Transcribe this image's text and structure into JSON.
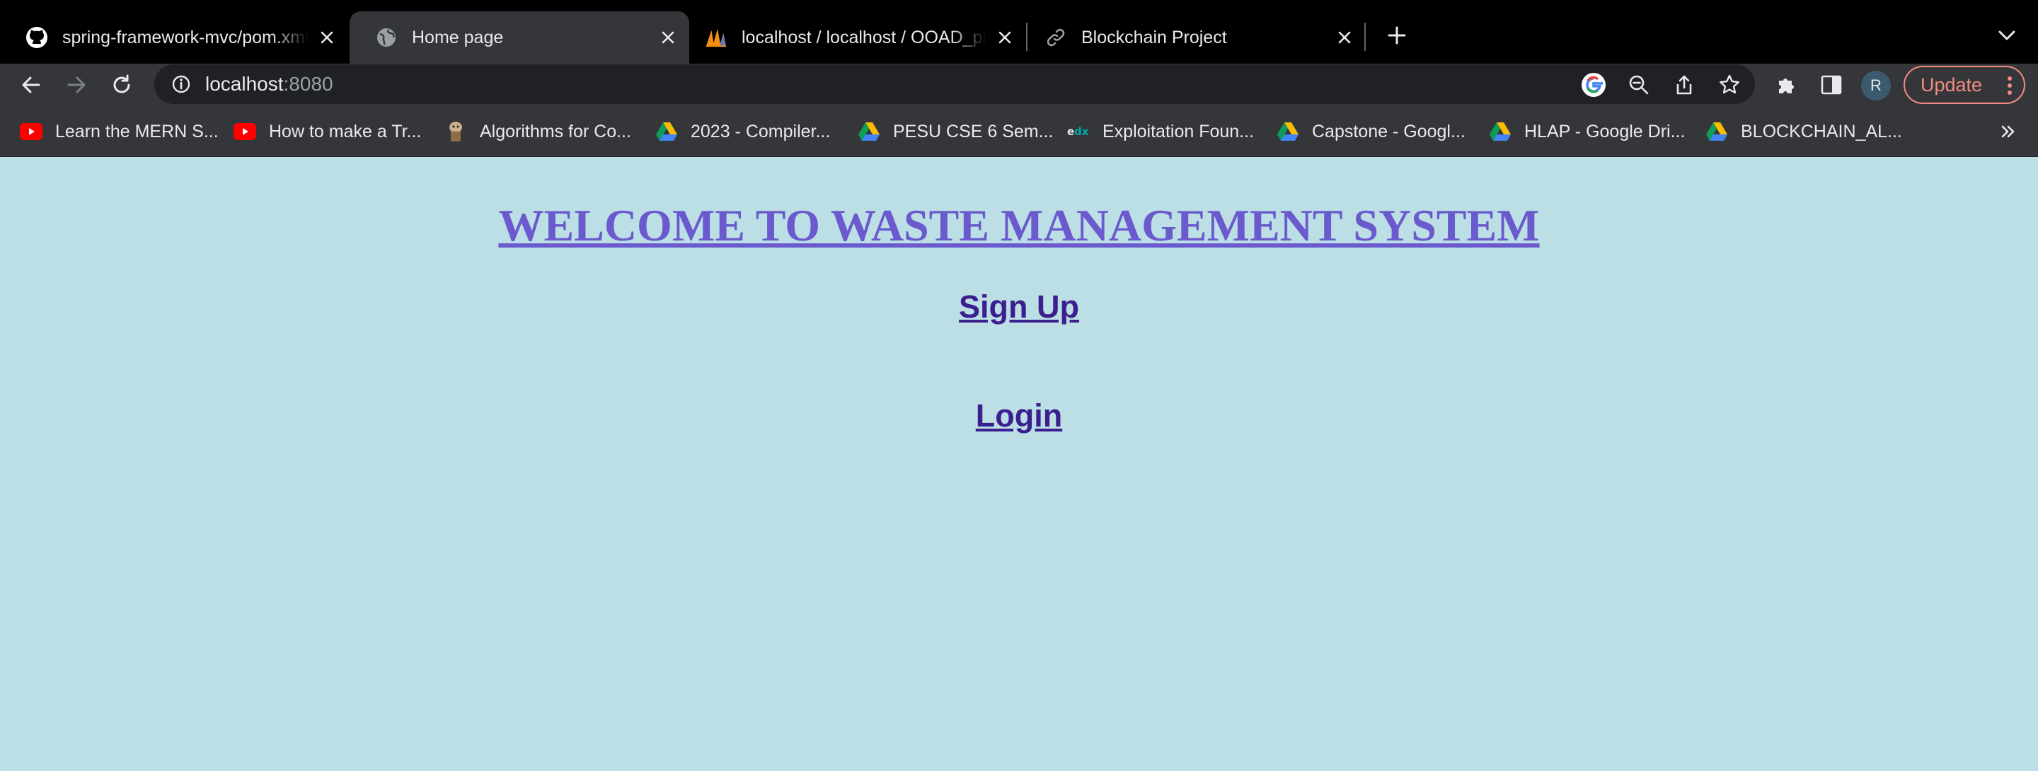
{
  "tabs": [
    {
      "title": "spring-framework-mvc/pom.xml",
      "icon": "github-icon",
      "active": false
    },
    {
      "title": "Home page",
      "icon": "globe-icon",
      "active": true
    },
    {
      "title": "localhost / localhost / OOAD_project",
      "icon": "phpmyadmin-icon",
      "active": false
    },
    {
      "title": "Blockchain Project",
      "icon": "link-icon",
      "active": false
    }
  ],
  "toolbar": {
    "url_host": "localhost",
    "url_port": ":8080",
    "avatar_initial": "R",
    "update_label": "Update"
  },
  "bookmarks": [
    {
      "label": "Learn the MERN S...",
      "icon": "youtube-icon"
    },
    {
      "label": "How to make a Tr...",
      "icon": "youtube-icon"
    },
    {
      "label": "Algorithms for Co...",
      "icon": "book-icon"
    },
    {
      "label": "2023 - Compiler...",
      "icon": "google-drive-icon"
    },
    {
      "label": "PESU CSE 6 Sem...",
      "icon": "google-drive-icon"
    },
    {
      "label": "Exploitation Foun...",
      "icon": "edx-icon"
    },
    {
      "label": "Capstone - Googl...",
      "icon": "google-drive-icon"
    },
    {
      "label": "HLAP - Google Dri...",
      "icon": "google-drive-icon"
    },
    {
      "label": "BLOCKCHAIN_AL...",
      "icon": "google-drive-icon"
    }
  ],
  "page": {
    "heading": "WELCOME TO WASTE MANAGEMENT SYSTEM",
    "signup_label": "Sign Up",
    "login_label": "Login"
  },
  "colors": {
    "page_background": "#bcdfe5",
    "heading": "#6a5acd",
    "link": "#3b1f8f",
    "update_accent": "#f28b82"
  }
}
